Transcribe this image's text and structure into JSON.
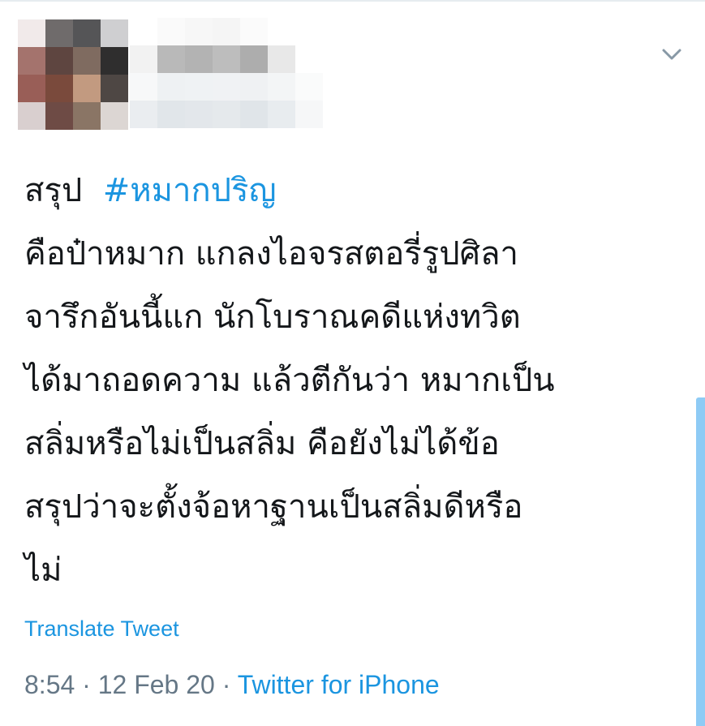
{
  "tweet": {
    "lines": [
      "คือป๋าหมาก แกลงไอจรสตอรี่รูปศิลา",
      "จารึกอันนี้แก นักโบราณคดีแห่งทวิต",
      "ได้มาถอดความ แล้วตีกันว่า หมากเป็น",
      "สลิ่มหรือไม่เป็นสลิ่ม คือยังไม่ได้ข้อ",
      "สรุปว่าจะตั้งจ้อหาฐานเป็นสลิ่มดีหรือ",
      "ไม่"
    ],
    "prefix": "สรุป",
    "hashtag": "#หมากปริญ"
  },
  "translate_label": "Translate Tweet",
  "meta": {
    "time": "8:54",
    "separator1": " · ",
    "date": "12 Feb 20",
    "separator2": " · ",
    "source": "Twitter for iPhone"
  },
  "icons": {
    "chevron": "chevron-down-icon"
  },
  "colors": {
    "link": "#1b95e0",
    "meta": "#657786",
    "text": "#14171a",
    "scrollbar": "#8ecbf5"
  }
}
